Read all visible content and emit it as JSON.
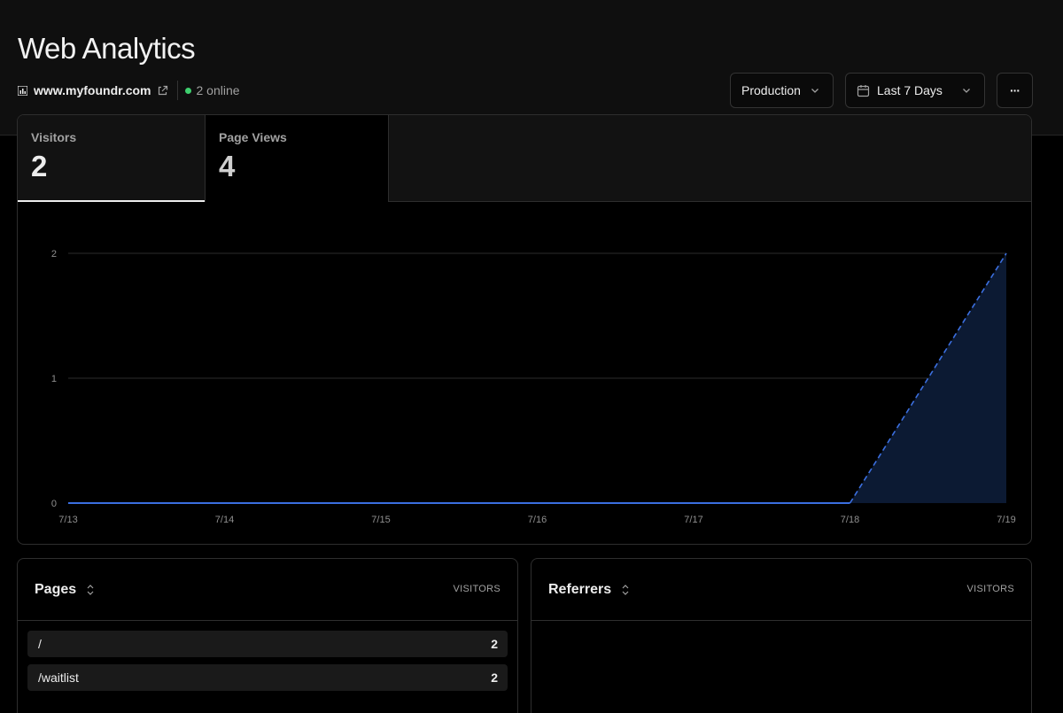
{
  "header": {
    "title": "Web Analytics",
    "domain": "www.myfoundr.com",
    "online": "2 online",
    "environment": "Production",
    "date_range": "Last 7 Days",
    "more": "···"
  },
  "tabs": [
    {
      "label": "Visitors",
      "value": "2"
    },
    {
      "label": "Page Views",
      "value": "4"
    }
  ],
  "chart_data": {
    "type": "area",
    "x": [
      "7/13",
      "7/14",
      "7/15",
      "7/16",
      "7/17",
      "7/18",
      "7/19"
    ],
    "series": [
      {
        "values": [
          0,
          0,
          0,
          0,
          0,
          0,
          2
        ]
      }
    ],
    "ylim": [
      0,
      2
    ],
    "yticks": [
      0,
      1,
      2
    ],
    "grid": true,
    "line_color": "#3b6fe0",
    "fill_color": "#0c1a33",
    "dashed_last_segment": true
  },
  "pages_panel": {
    "title": "Pages",
    "column": "VISITORS",
    "rows": [
      {
        "path": "/",
        "visitors": "2"
      },
      {
        "path": "/waitlist",
        "visitors": "2"
      }
    ]
  },
  "referrers_panel": {
    "title": "Referrers",
    "column": "VISITORS"
  }
}
